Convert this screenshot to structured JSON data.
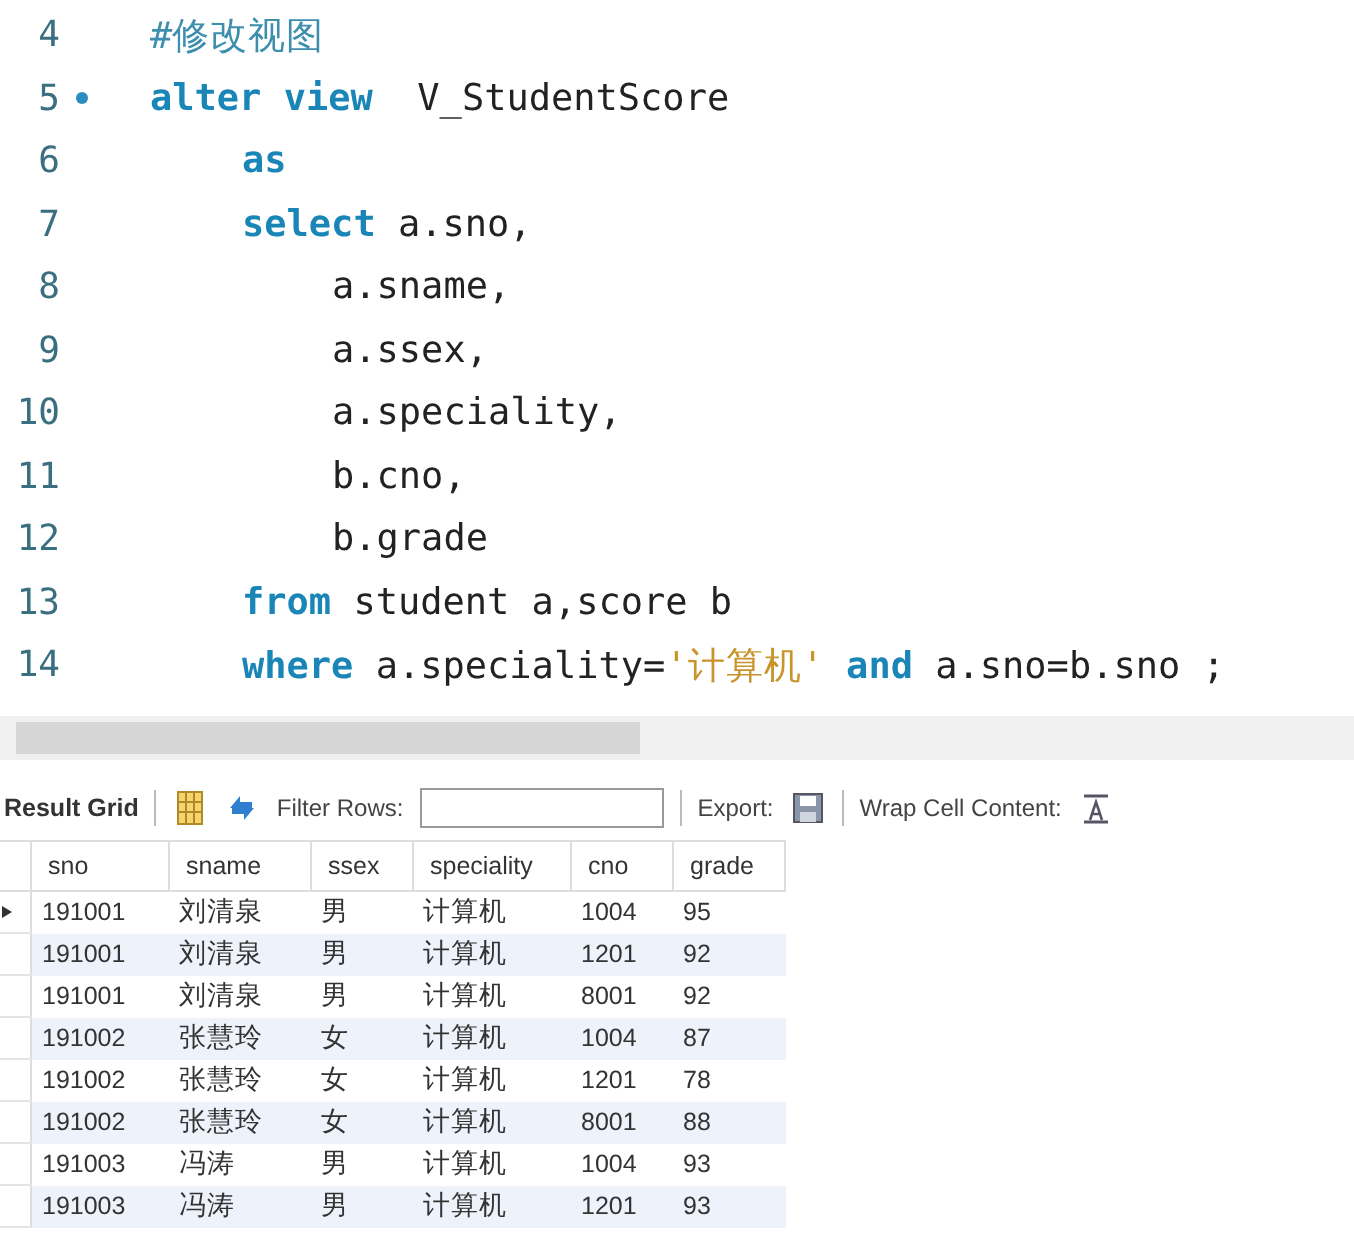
{
  "editor": {
    "lines": [
      {
        "number": "4",
        "marker": false,
        "kind": "top",
        "segments": [
          {
            "kind": "comment",
            "text": "#修改视图"
          }
        ]
      },
      {
        "number": "5",
        "marker": true,
        "kind": "top",
        "segments": [
          {
            "kind": "keyword",
            "text": "alter view"
          },
          {
            "kind": "plain",
            "text": "  V_StudentScore"
          }
        ]
      },
      {
        "number": "6",
        "marker": false,
        "kind": "clause",
        "segments": [
          {
            "kind": "keyword",
            "text": "as"
          }
        ]
      },
      {
        "number": "7",
        "marker": false,
        "kind": "clause",
        "segments": [
          {
            "kind": "keyword",
            "text": "select"
          },
          {
            "kind": "plain",
            "text": " a.sno,"
          }
        ]
      },
      {
        "number": "8",
        "marker": false,
        "kind": "column",
        "segments": [
          {
            "kind": "plain",
            "text": "a.sname,"
          }
        ]
      },
      {
        "number": "9",
        "marker": false,
        "kind": "column",
        "segments": [
          {
            "kind": "plain",
            "text": "a.ssex,"
          }
        ]
      },
      {
        "number": "10",
        "marker": false,
        "kind": "column",
        "segments": [
          {
            "kind": "plain",
            "text": "a.speciality,"
          }
        ]
      },
      {
        "number": "11",
        "marker": false,
        "kind": "column",
        "segments": [
          {
            "kind": "plain",
            "text": "b.cno,"
          }
        ]
      },
      {
        "number": "12",
        "marker": false,
        "kind": "column",
        "segments": [
          {
            "kind": "plain",
            "text": "b.grade"
          }
        ]
      },
      {
        "number": "13",
        "marker": false,
        "kind": "clause",
        "segments": [
          {
            "kind": "keyword",
            "text": "from"
          },
          {
            "kind": "plain",
            "text": " student a,score b"
          }
        ]
      },
      {
        "number": "14",
        "marker": false,
        "kind": "clause",
        "segments": [
          {
            "kind": "keyword",
            "text": "where"
          },
          {
            "kind": "plain",
            "text": " a.speciality="
          },
          {
            "kind": "string",
            "text": "'计算机'"
          },
          {
            "kind": "keyword",
            "text": " and"
          },
          {
            "kind": "plain",
            "text": " a.sno=b.sno ;"
          }
        ]
      }
    ]
  },
  "toolbar": {
    "result_grid": "Result Grid",
    "filter_label": "Filter Rows:",
    "export_label": "Export:",
    "wrap_label": "Wrap Cell Content:"
  },
  "table": {
    "columns": [
      "sno",
      "sname",
      "ssex",
      "speciality",
      "cno",
      "grade"
    ],
    "rows": [
      {
        "selected": true,
        "cells": [
          "191001",
          "刘清泉",
          "男",
          "计算机",
          "1004",
          "95"
        ]
      },
      {
        "selected": false,
        "cells": [
          "191001",
          "刘清泉",
          "男",
          "计算机",
          "1201",
          "92"
        ]
      },
      {
        "selected": false,
        "cells": [
          "191001",
          "刘清泉",
          "男",
          "计算机",
          "8001",
          "92"
        ]
      },
      {
        "selected": false,
        "cells": [
          "191002",
          "张慧玲",
          "女",
          "计算机",
          "1004",
          "87"
        ]
      },
      {
        "selected": false,
        "cells": [
          "191002",
          "张慧玲",
          "女",
          "计算机",
          "1201",
          "78"
        ]
      },
      {
        "selected": false,
        "cells": [
          "191002",
          "张慧玲",
          "女",
          "计算机",
          "8001",
          "88"
        ]
      },
      {
        "selected": false,
        "cells": [
          "191003",
          "冯涛",
          "男",
          "计算机",
          "1004",
          "93"
        ]
      },
      {
        "selected": false,
        "cells": [
          "191003",
          "冯涛",
          "男",
          "计算机",
          "1201",
          "93"
        ]
      }
    ]
  }
}
